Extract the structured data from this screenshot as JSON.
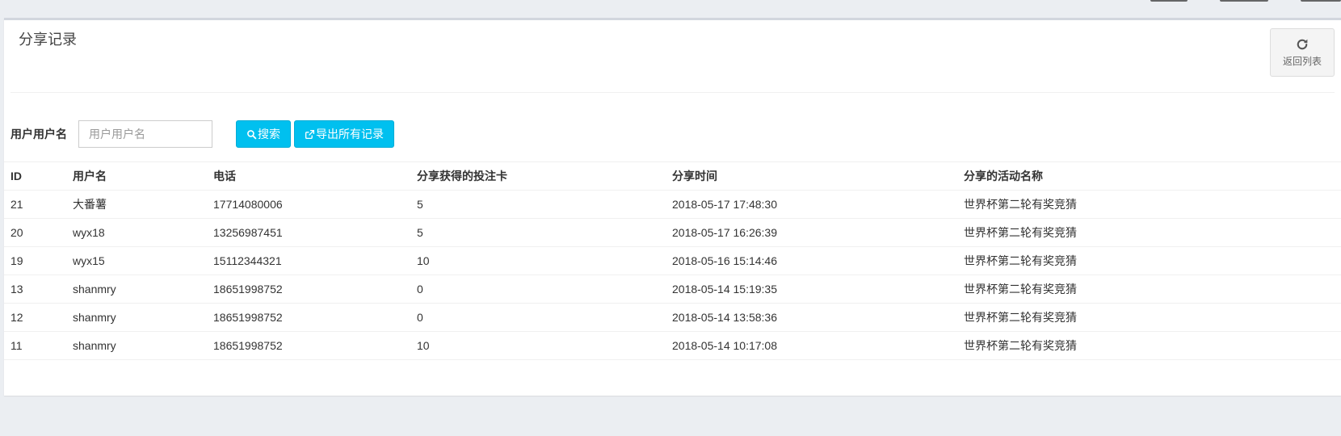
{
  "page": {
    "title": "分享记录",
    "back_label": "返回列表"
  },
  "search": {
    "label": "用户用户名",
    "placeholder": "用户用户名",
    "value": "",
    "search_button": "搜索",
    "export_button": "导出所有记录"
  },
  "table": {
    "headers": [
      "ID",
      "用户名",
      "电话",
      "分享获得的投注卡",
      "分享时间",
      "分享的活动名称"
    ],
    "rows": [
      [
        "21",
        "大番薯",
        "17714080006",
        "5",
        "2018-05-17 17:48:30",
        "世界杯第二轮有奖竞猜"
      ],
      [
        "20",
        "wyx18",
        "13256987451",
        "5",
        "2018-05-17 16:26:39",
        "世界杯第二轮有奖竞猜"
      ],
      [
        "19",
        "wyx15",
        "15112344321",
        "10",
        "2018-05-16 15:14:46",
        "世界杯第二轮有奖竞猜"
      ],
      [
        "13",
        "shanmry",
        "18651998752",
        "0",
        "2018-05-14 15:19:35",
        "世界杯第二轮有奖竞猜"
      ],
      [
        "12",
        "shanmry",
        "18651998752",
        "0",
        "2018-05-14 13:58:36",
        "世界杯第二轮有奖竞猜"
      ],
      [
        "11",
        "shanmry",
        "18651998752",
        "10",
        "2018-05-14 10:17:08",
        "世界杯第二轮有奖竞猜"
      ]
    ]
  },
  "icons": {
    "back": "refresh-icon",
    "search": "search-icon",
    "export": "external-link-icon"
  },
  "colors": {
    "accent": "#00c0ef",
    "background": "#ebeef2",
    "panel": "#ffffff"
  }
}
